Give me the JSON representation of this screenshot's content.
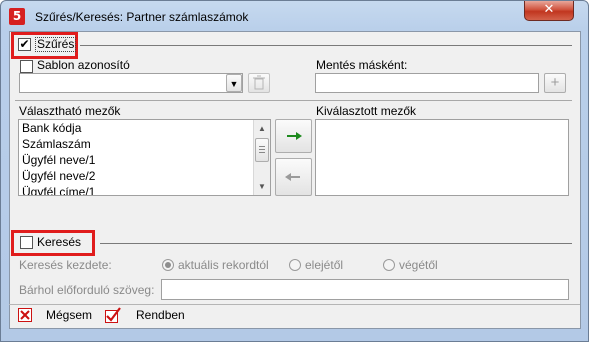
{
  "window": {
    "title": "Szűrés/Keresés: Partner számlaszámok",
    "app_icon_glyph": "5",
    "close_glyph": "✕"
  },
  "filter_section": {
    "checkbox_label": "Szűrés",
    "checked": true,
    "template_id_label": "Sablon azonosító",
    "template_id_value": "",
    "save_as_label": "Mentés másként:",
    "save_as_value": "",
    "add_glyph": "+",
    "available_fields_label": "Választható mezők",
    "available_fields": [
      "Bank kódja",
      "Számlaszám",
      "Ügyfél neve/1",
      "Ügyfél neve/2",
      "Ügyfél címe/1"
    ],
    "selected_fields_label": "Kiválasztott mezők",
    "selected_fields": []
  },
  "search_section": {
    "checkbox_label": "Keresés",
    "checked": false,
    "search_start_label": "Keresés kezdete:",
    "options": [
      "aktuális rekordtól",
      "elejétől",
      "végétől"
    ],
    "selected_option": "aktuális rekordtól",
    "anywhere_label": "Bárhol előforduló szöveg:",
    "anywhere_value": ""
  },
  "footer": {
    "cancel_label": "Mégsem",
    "ok_label": "Rendben"
  },
  "colors": {
    "highlight_box": "#e01c1c",
    "add_arrow": "#1e8a1e",
    "remove_arrow": "#9a9a9a",
    "cancel_icon": "#cc1111"
  }
}
